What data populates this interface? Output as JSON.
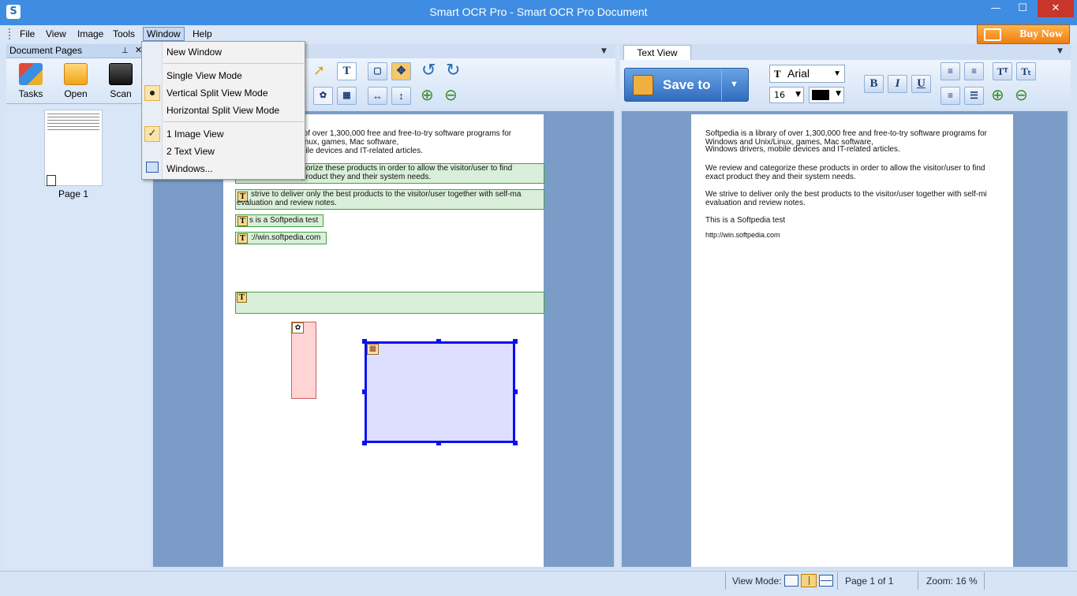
{
  "window": {
    "title": "Smart OCR Pro - Smart OCR Pro Document",
    "icon_letter": "S"
  },
  "window_buttons": {
    "minimize": "—",
    "maximize": "☐",
    "close": "✕"
  },
  "menu": [
    {
      "label": "File"
    },
    {
      "label": "View"
    },
    {
      "label": "Image"
    },
    {
      "label": "Tools"
    },
    {
      "label": "Window"
    },
    {
      "label": "Help"
    }
  ],
  "buy_now": "Buy Now",
  "left_panel": {
    "title": "Document Pages",
    "tools": [
      {
        "label": "Tasks",
        "icon": "tasks-icon"
      },
      {
        "label": "Open",
        "icon": "folder-icon"
      },
      {
        "label": "Scan",
        "icon": "scanner-icon"
      }
    ],
    "page_label": "Page 1"
  },
  "window_menu": {
    "new_window": "New Window",
    "single_view": "Single View Mode",
    "vertical_split": "Vertical Split View Mode",
    "horizontal_split": "Horizontal Split View Mode",
    "image_view": "1 Image View",
    "text_view": "2 Text View",
    "windows": "Windows..."
  },
  "text_panel": {
    "tab": "Text View",
    "save_to": "Save to",
    "font": "Arial",
    "font_size": "16",
    "text_color": "#000000"
  },
  "image_doc": {
    "line1": "ary of over 1,300,000 free and free-to-try software programs for",
    "line2": "ix/Linux, games, Mac software,",
    "line3": "mobile devices and IT-related articles.",
    "box2_line1": "tegorize these products in order to allow the visitor/user to find",
    "box2_line2": "act product they and their system needs.",
    "box3_line1": "strive to deliver only the best products to the visitor/user together with self-ma",
    "box3_line2": "evaluation and review notes.",
    "box4": "s is a Softpedia test",
    "box5": "://win.softpedia.com"
  },
  "text_doc": {
    "p1_l1": "Softpedia is a library of over 1,300,000 free and free-to-try software programs for",
    "p1_l2": "Windows and Unix/Linux, games, Mac software,",
    "p1_l3": "Windows drivers, mobile devices and IT-related articles.",
    "p2_l1": "We review and categorize these products in order to allow the visitor/user to find",
    "p2_l2": "exact product they and their system needs.",
    "p3_l1": "We strive to deliver only the best products to the visitor/user together with self-mi",
    "p3_l2": "evaluation and review notes.",
    "p4": "This is a Softpedia test",
    "p5": "http://win.softpedia.com"
  },
  "status": {
    "view_mode_label": "View Mode:",
    "page": "Page 1 of 1",
    "zoom": "Zoom: 16 %"
  },
  "colors": {
    "titlebar": "#3e8de2",
    "accent": "#2f6cbc",
    "selection": "#0000ff",
    "ocr_text_zone": "#46a046",
    "image_zone": "#e07070"
  }
}
